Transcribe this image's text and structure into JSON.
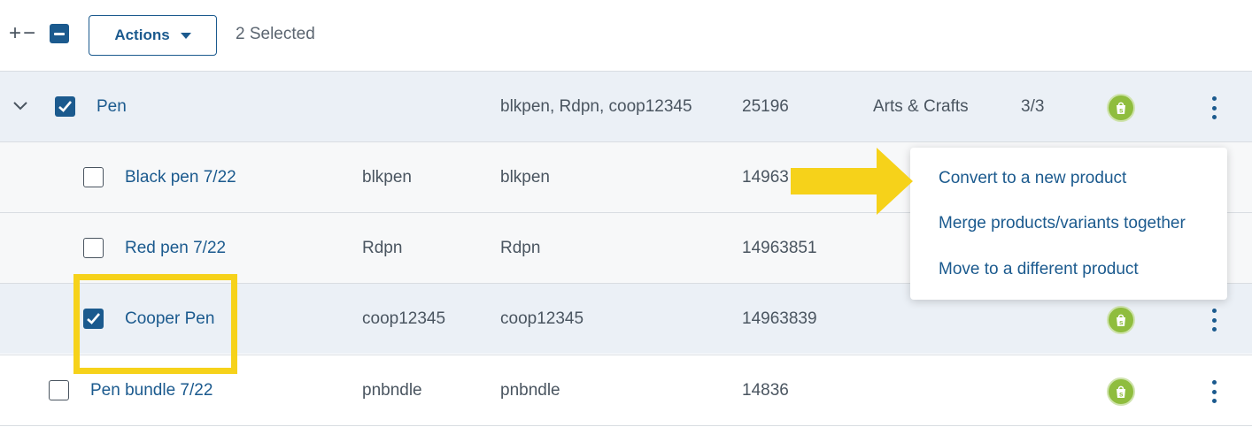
{
  "toolbar": {
    "plus_minus": "+−",
    "actions_label": "Actions",
    "selected_text": "2 Selected"
  },
  "rows": {
    "parent": {
      "name": "Pen",
      "skus": "blkpen, Rdpn, coop12345",
      "id": "25196",
      "category": "Arts & Crafts",
      "count": "3/3",
      "checked": true
    },
    "variants": [
      {
        "name": "Black pen 7/22",
        "sku1": "blkpen",
        "sku2": "blkpen",
        "id": "14963",
        "checked": false
      },
      {
        "name": "Red pen 7/22",
        "sku1": "Rdpn",
        "sku2": "Rdpn",
        "id": "14963851",
        "checked": false
      },
      {
        "name": "Cooper Pen",
        "sku1": "coop12345",
        "sku2": "coop12345",
        "id": "14963839",
        "checked": true
      }
    ],
    "single": {
      "name": "Pen bundle 7/22",
      "sku1": "pnbndle",
      "sku2": "pnbndle",
      "id": "14836",
      "checked": false
    }
  },
  "menu": {
    "items": [
      "Convert to a new product",
      "Merge products/variants together",
      "Move to a different product"
    ]
  },
  "colors": {
    "primary": "#1b5a8e",
    "shopify_green": "#8fbd3e",
    "highlight_yellow": "#f6d21a",
    "parent_row_bg": "#ebf0f6"
  },
  "icons": {
    "expand": "chevron-down-icon",
    "store": "shopify-icon",
    "row_menu": "kebab-menu-icon"
  }
}
